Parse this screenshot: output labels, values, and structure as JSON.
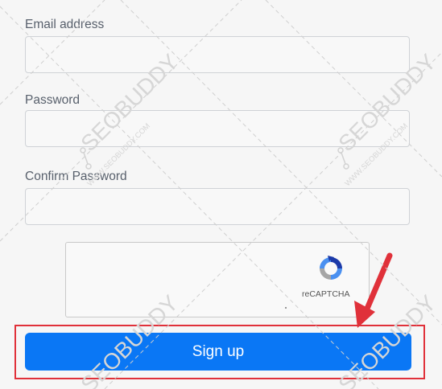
{
  "form": {
    "email_label": "Email address",
    "email_value": "",
    "password_label": "Password",
    "password_value": "",
    "confirm_label": "Confirm Password",
    "confirm_value": ""
  },
  "captcha": {
    "label": "reCAPTCHA"
  },
  "signup_button": {
    "label": "Sign up"
  },
  "watermark": {
    "brand": "SEOBUDDY",
    "url": "WWW.SEOBUDDY.COM"
  },
  "colors": {
    "primary_button": "#0a77f5",
    "highlight_border": "#e0313a",
    "arrow": "#e0313a"
  }
}
